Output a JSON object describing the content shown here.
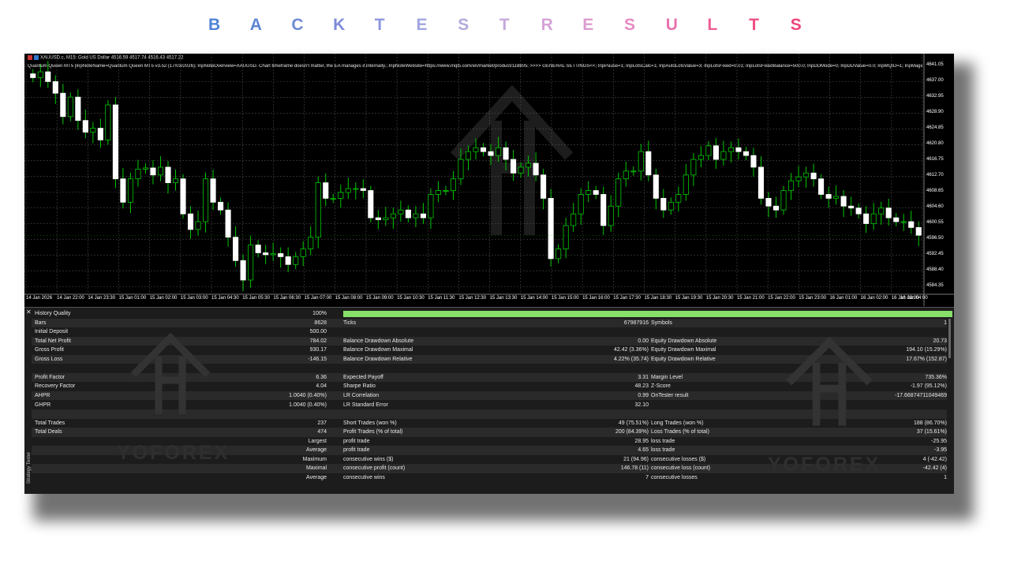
{
  "title": {
    "letters": [
      "B",
      "A",
      "C",
      "K",
      "T",
      "E",
      "S",
      "T",
      "R",
      "E",
      "S",
      "U",
      "L",
      "T",
      "S"
    ],
    "colors": [
      "#4f83d6",
      "#5f85d2",
      "#6d8ad4",
      "#7f8bd9",
      "#8e98dd",
      "#a0a6e0",
      "#b3a9dd",
      "#c6a9dc",
      "#d5a3d8",
      "#dd9ccf",
      "#e58bc3",
      "#e972ad",
      "#ec5f99",
      "#ee4f86",
      "#f0447a"
    ]
  },
  "chart": {
    "symbol": "XAUUSD.c, M15:  Gold US Dollar  4516.59 4517.74 4516.43 4517.22",
    "params": "Quantum Queen MT5 [InpNoteName=Quantum Queen MT5 v3.52 (17/03/2026); InpNoteOverview=XAUUSD. Chart timeframe doesn't matter, the EA manages it internally.; InpNoteWebsite=https://www.mql5.com/en/market/product/118805; >>>> GENERAL SETTINGS<<; InpPause=1; InpLotsCalc=1; InpAutoLotsValue=3; InpLotsFixed=0.01; InpLotsFixedBalance=500.0; InpDDMode=0; InpDDValue=0.0; InpMQID=1; InpMagicNumber=",
    "price_ticks": [
      "4641.05",
      "4637.00",
      "4632.95",
      "4628.90",
      "4624.85",
      "4620.80",
      "4616.75",
      "4612.70",
      "4608.65",
      "4604.60",
      "4600.55",
      "4596.50",
      "4592.45",
      "4588.40",
      "4584.35"
    ],
    "time_ticks": [
      "14 Jan 2026",
      "14 Jan 22:00",
      "14 Jan 23:30",
      "15 Jan 01:00",
      "15 Jan 02:00",
      "15 Jan 03:00",
      "15 Jan 04:30",
      "15 Jan 05:30",
      "15 Jan 06:30",
      "15 Jan 07:00",
      "15 Jan 08:00",
      "15 Jan 09:00",
      "15 Jan 10:30",
      "15 Jan 11:30",
      "15 Jan 12:30",
      "15 Jan 13:30",
      "15 Jan 14:00",
      "15 Jan 15:00",
      "15 Jan 16:00",
      "15 Jan 17:30",
      "15 Jan 18:30",
      "15 Jan 19:30",
      "15 Jan 20:30",
      "15 Jan 21:00",
      "15 Jan 22:00",
      "15 Jan 23:00",
      "16 Jan 01:00",
      "16 Jan 02:00",
      "16 Jan 03:00",
      "16 Jan 04:00"
    ],
    "closes": [
      4638,
      4639.5,
      4637,
      4634,
      4628,
      4633,
      4627,
      4624,
      4625,
      4622,
      4631,
      4612,
      4606,
      4612,
      4614.5,
      4614.8,
      4613,
      4615,
      4611,
      4612,
      4603,
      4599,
      4601,
      4612,
      4606,
      4604,
      4597,
      4591,
      4586,
      4595,
      4593,
      4592.5,
      4592.8,
      4592,
      4590,
      4592,
      4594,
      4597,
      4611,
      4607,
      4607,
      4608.5,
      4609.5,
      4609.5,
      4609,
      4602,
      4601.5,
      4602,
      4603,
      4604,
      4602,
      4603,
      4602,
      4608,
      4609,
      4609,
      4612,
      4617,
      4619,
      4620,
      4619,
      4618,
      4620,
      4617,
      4613.5,
      4615,
      4616,
      4613,
      4607,
      4591.5,
      4594,
      4600,
      4603,
      4608,
      4609,
      4608,
      4600,
      4605,
      4612,
      4614,
      4614,
      4619,
      4613,
      4607,
      4604,
      4606,
      4608,
      4613,
      4617,
      4618,
      4620.5,
      4617,
      4619,
      4620,
      4619,
      4618,
      4615,
      4607,
      4605,
      4604,
      4609,
      4611.5,
      4612.5,
      4613.5,
      4612,
      4608,
      4607,
      4607.5,
      4605,
      4604.5,
      4603,
      4600.5,
      4603,
      4604.5,
      4602,
      4601,
      4601,
      4599.5,
      4597.5
    ],
    "watermark": "YOFOREX"
  },
  "report": {
    "side_tab": "Strategy Tester",
    "rows": [
      {
        "c1l": "History Quality",
        "c1v": "100%",
        "bar": true
      },
      {
        "c1l": "Bars",
        "c1v": "8628",
        "c2l": "Ticks",
        "c2v": "67987916",
        "c3l": "Symbols",
        "c3v": "1"
      },
      {
        "c1l": "Initial Deposit",
        "c1v": "500.00"
      },
      {
        "c1l": "Total Net Profit",
        "c1v": "784.02",
        "c2l": "Balance Drawdown Absolute",
        "c2v": "0.00",
        "c3l": "Equity Drawdown Absolute",
        "c3v": "20.73"
      },
      {
        "c1l": "Gross Profit",
        "c1v": "930.17",
        "c2l": "Balance Drawdown Maximal",
        "c2v": "42.42 (3.36%)",
        "c3l": "Equity Drawdown Maximal",
        "c3v": "194.10 (15.29%)"
      },
      {
        "c1l": "Gross Loss",
        "c1v": "-146.15",
        "c2l": "Balance Drawdown Relative",
        "c2v": "4.22% (35.74)",
        "c3l": "Equity Drawdown Relative",
        "c3v": "17.67% (152.87)"
      },
      {},
      {
        "c1l": "Profit Factor",
        "c1v": "6.36",
        "c2l": "Expected Payoff",
        "c2v": "3.31",
        "c3l": "Margin Level",
        "c3v": "735.36%"
      },
      {
        "c1l": "Recovery Factor",
        "c1v": "4.04",
        "c2l": "Sharpe Ratio",
        "c2v": "48.23",
        "c3l": "Z-Score",
        "c3v": "-1.97 (95.12%)"
      },
      {
        "c1l": "AHPR",
        "c1v": "1.0040 (0.40%)",
        "c2l": "LR Correlation",
        "c2v": "0.99",
        "c3l": "OnTester result",
        "c3v": "-17.66874711049469"
      },
      {
        "c1l": "GHPR",
        "c1v": "1.0040 (0.40%)",
        "c2l": "LR Standard Error",
        "c2v": "32.10"
      },
      {},
      {
        "c1l": "Total Trades",
        "c1v": "237",
        "c2l": "Short Trades (won %)",
        "c2v": "49 (75.51%)",
        "c3l": "Long Trades (won %)",
        "c3v": "188 (86.70%)"
      },
      {
        "c1l": "Total Deals",
        "c1v": "474",
        "c2l": "Profit Trades (% of total)",
        "c2v": "200 (84.39%)",
        "c3l": "Loss Trades (% of total)",
        "c3v": "37 (15.61%)"
      },
      {
        "c1v": "Largest",
        "c2l": "profit trade",
        "c2v": "28.95",
        "c3l": "loss trade",
        "c3v": "-25.95"
      },
      {
        "c1v": "Average",
        "c2l": "profit trade",
        "c2v": "4.65",
        "c3l": "loss trade",
        "c3v": "-3.95"
      },
      {
        "c1v": "Maximum",
        "c2l": "consecutive wins ($)",
        "c2v": "21 (94.96)",
        "c3l": "consecutive losses ($)",
        "c3v": "4 (-42.42)"
      },
      {
        "c1v": "Maximal",
        "c2l": "consecutive profit (count)",
        "c2v": "146.78 (11)",
        "c3l": "consecutive loss (count)",
        "c3v": "-42.42 (4)"
      },
      {
        "c1v": "Average",
        "c2l": "consecutive wins",
        "c2v": "7",
        "c3l": "consecutive losses",
        "c3v": "1"
      }
    ]
  }
}
